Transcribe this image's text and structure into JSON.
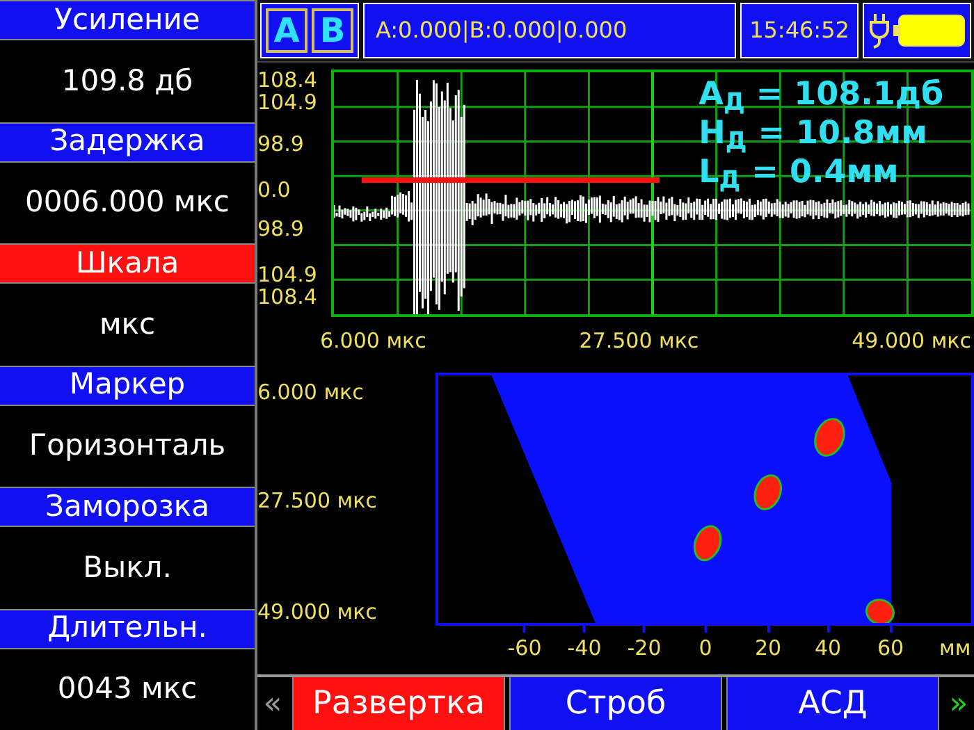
{
  "sidebar": {
    "items": [
      {
        "label": "Усиление",
        "value": "109.8 дб",
        "selected": false
      },
      {
        "label": "Задержка",
        "value": "0006.000 мкс",
        "selected": false
      },
      {
        "label": "Шкала",
        "value": "мкс",
        "selected": true
      },
      {
        "label": "Маркер",
        "value": "Горизонталь",
        "selected": false
      },
      {
        "label": "Заморозка",
        "value": "Выкл.",
        "selected": false
      },
      {
        "label": "Длительн.",
        "value": "0043 мкс",
        "selected": false
      }
    ]
  },
  "status_bar": {
    "channels": [
      "A",
      "B"
    ],
    "readings": "A:0.000|B:0.000|0.000",
    "time": "15:46:52"
  },
  "a_scan": {
    "y_labels": [
      "108.4",
      "104.9",
      "98.9",
      "0.0",
      "98.9",
      "104.9",
      "108.4"
    ],
    "x_labels": [
      "6.000 мкс",
      "27.500 мкс",
      "49.000 мкс"
    ],
    "measurements": [
      "A$_{Д}$ = 108.1дб",
      "H$_{Д}$ = 10.8мм",
      "L$_{Д}$ = 0.4мм"
    ]
  },
  "b_scan": {
    "y_labels": [
      "6.000 мкс",
      "27.500 мкс",
      "49.000 мкс"
    ],
    "x_labels": [
      "-60",
      "-40",
      "-20",
      "0",
      "20",
      "40",
      "60"
    ],
    "x_unit": "мм"
  },
  "bottom_menu": {
    "prev": "«",
    "next": "»",
    "tabs": [
      {
        "label": "Развертка",
        "selected": true
      },
      {
        "label": "Строб",
        "selected": false
      },
      {
        "label": "АСД",
        "selected": false
      }
    ]
  }
}
